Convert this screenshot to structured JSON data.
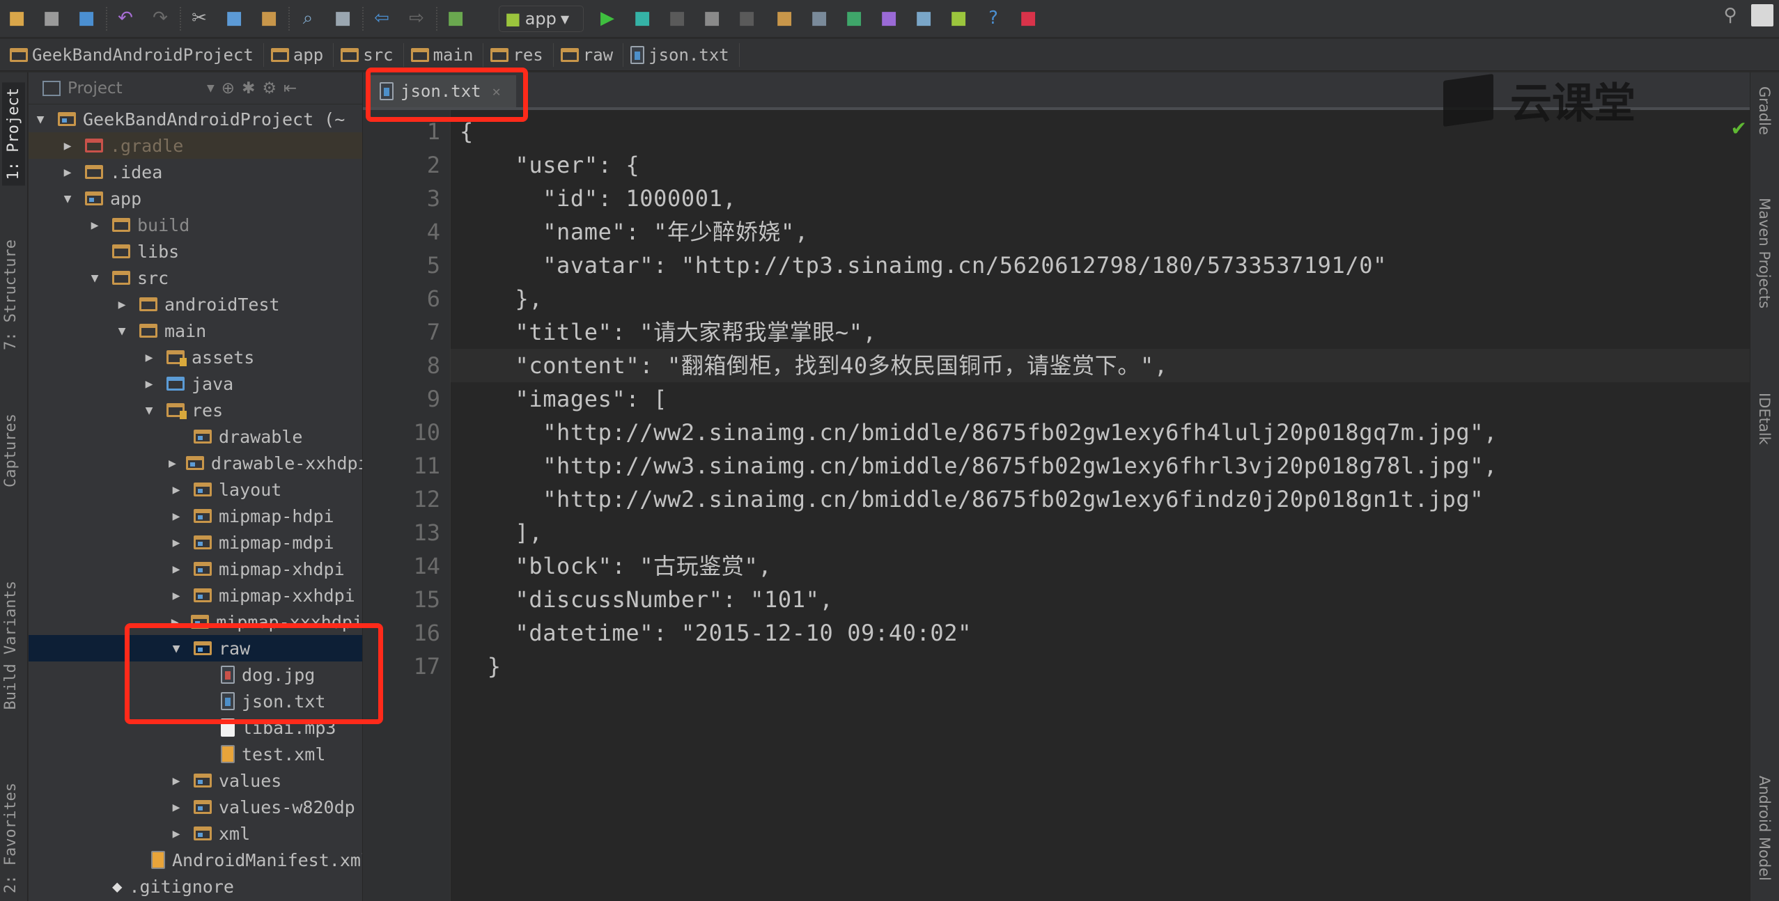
{
  "toolbar": {
    "icons": [
      "open-folder",
      "save",
      "sync",
      "undo",
      "redo",
      "cut",
      "copy",
      "paste",
      "find",
      "replace",
      "back",
      "forward",
      "make-project"
    ],
    "run_config": "app",
    "run_icons": [
      "run",
      "debug",
      "attach-debugger",
      "run-coverage",
      "stop"
    ],
    "tool_icons": [
      "project-structure",
      "sdk-manager",
      "gradle-sync",
      "avd-manager",
      "device-monitor",
      "android",
      "help",
      "android-device"
    ],
    "search": "search-icon",
    "user": "user-avatar"
  },
  "breadcrumb": [
    "GeekBandAndroidProject",
    "app",
    "src",
    "main",
    "res",
    "raw",
    "json.txt"
  ],
  "left_strip": [
    "1: Project",
    "7: Structure",
    "Captures",
    "Build Variants",
    "2: Favorites"
  ],
  "right_strip": [
    "Gradle",
    "Maven Projects",
    "IDEtalk",
    "Android Model"
  ],
  "project_panel": {
    "title": "Project",
    "tree": [
      {
        "label": "GeekBandAndroidProject (~",
        "level": 0,
        "arrow": "down",
        "icon": "module"
      },
      {
        "label": ".gradle",
        "level": 1,
        "arrow": "right",
        "icon": "folder-red",
        "state": "gradle"
      },
      {
        "label": ".idea",
        "level": 1,
        "arrow": "right",
        "icon": "folder"
      },
      {
        "label": "app",
        "level": 1,
        "arrow": "down",
        "icon": "module"
      },
      {
        "label": "build",
        "level": 2,
        "arrow": "right",
        "icon": "folder",
        "state": "dim"
      },
      {
        "label": "libs",
        "level": 2,
        "arrow": "",
        "icon": "folder"
      },
      {
        "label": "src",
        "level": 2,
        "arrow": "down",
        "icon": "folder"
      },
      {
        "label": "androidTest",
        "level": 3,
        "arrow": "right",
        "icon": "folder"
      },
      {
        "label": "main",
        "level": 3,
        "arrow": "down",
        "icon": "folder"
      },
      {
        "label": "assets",
        "level": 4,
        "arrow": "right",
        "icon": "folder-res"
      },
      {
        "label": "java",
        "level": 4,
        "arrow": "right",
        "icon": "folder-blue"
      },
      {
        "label": "res",
        "level": 4,
        "arrow": "down",
        "icon": "folder-res"
      },
      {
        "label": "drawable",
        "level": 5,
        "arrow": "",
        "icon": "folder-dot"
      },
      {
        "label": "drawable-xxhdpi",
        "level": 5,
        "arrow": "right",
        "icon": "folder-dot"
      },
      {
        "label": "layout",
        "level": 5,
        "arrow": "right",
        "icon": "folder-dot"
      },
      {
        "label": "mipmap-hdpi",
        "level": 5,
        "arrow": "right",
        "icon": "folder-dot"
      },
      {
        "label": "mipmap-mdpi",
        "level": 5,
        "arrow": "right",
        "icon": "folder-dot"
      },
      {
        "label": "mipmap-xhdpi",
        "level": 5,
        "arrow": "right",
        "icon": "folder-dot"
      },
      {
        "label": "mipmap-xxhdpi",
        "level": 5,
        "arrow": "right",
        "icon": "folder-dot"
      },
      {
        "label": "mipmap-xxxhdpi",
        "level": 5,
        "arrow": "right",
        "icon": "folder-dot"
      },
      {
        "label": "raw",
        "level": 5,
        "arrow": "down",
        "icon": "folder-dot",
        "state": "sel"
      },
      {
        "label": "dog.jpg",
        "level": 6,
        "arrow": "",
        "icon": "file-jpg"
      },
      {
        "label": "json.txt",
        "level": 6,
        "arrow": "",
        "icon": "file-txt"
      },
      {
        "label": "libai.mp3",
        "level": 6,
        "arrow": "",
        "icon": "file-mp3"
      },
      {
        "label": "test.xml",
        "level": 6,
        "arrow": "",
        "icon": "file-xml"
      },
      {
        "label": "values",
        "level": 5,
        "arrow": "right",
        "icon": "folder-dot"
      },
      {
        "label": "values-w820dp",
        "level": 5,
        "arrow": "right",
        "icon": "folder-dot"
      },
      {
        "label": "xml",
        "level": 5,
        "arrow": "right",
        "icon": "folder-dot"
      },
      {
        "label": "AndroidManifest.xml",
        "level": 4,
        "arrow": "",
        "icon": "file-xml"
      },
      {
        "label": ".gitignore",
        "level": 2,
        "arrow": "",
        "icon": "git"
      }
    ]
  },
  "editor": {
    "tab": "json.txt",
    "current_line": 8,
    "lines": [
      "{",
      "    \"user\": {",
      "      \"id\": 1000001,",
      "      \"name\": \"年少醉娇娆\",",
      "      \"avatar\": \"http://tp3.sinaimg.cn/5620612798/180/5733537191/0\"",
      "    },",
      "    \"title\": \"请大家帮我掌掌眼~\",",
      "    \"content\": \"翻箱倒柜，找到40多枚民国铜币，请鉴赏下。\",",
      "    \"images\": [",
      "      \"http://ww2.sinaimg.cn/bmiddle/8675fb02gw1exy6fh4lulj20p018gq7m.jpg\",",
      "      \"http://ww3.sinaimg.cn/bmiddle/8675fb02gw1exy6fhrl3vj20p018g78l.jpg\",",
      "      \"http://ww2.sinaimg.cn/bmiddle/8675fb02gw1exy6findz0j20p018gn1t.jpg\"",
      "    ],",
      "    \"block\": \"古玩鉴赏\",",
      "    \"discussNumber\": \"101\",",
      "    \"datetime\": \"2015-12-10 09:40:02\"",
      "  }"
    ]
  },
  "watermark": "云课堂",
  "colors": {
    "highlight_box": "#ff2a1a",
    "selection": "#0d1f36",
    "folder": "#c8964a",
    "check": "#5fb833"
  }
}
